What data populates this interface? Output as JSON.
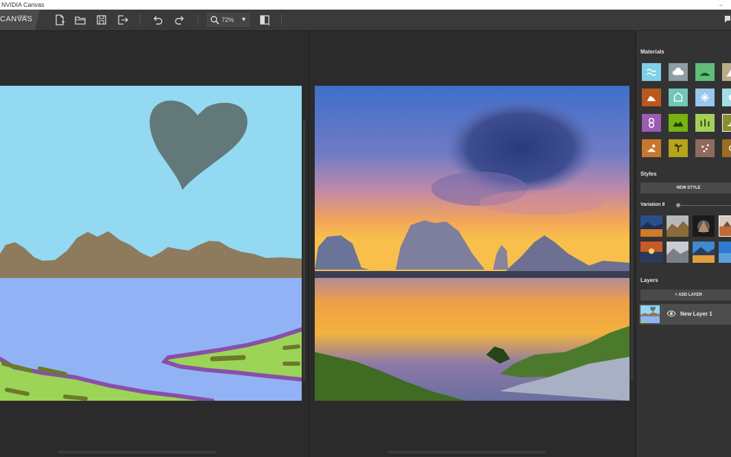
{
  "window": {
    "title": "NVIDIA Canvas"
  },
  "toolbar": {
    "brand": "CANVAS",
    "brand_badge": "BETA",
    "zoom_value": "72%",
    "buttons": [
      "new-file-icon",
      "open-folder-icon",
      "save-icon",
      "export-icon",
      "undo-icon",
      "redo-icon",
      "search-icon",
      "split-view-icon"
    ]
  },
  "sidebar": {
    "materials_title": "Materials",
    "materials": [
      {
        "name": "water",
        "color": "#7fd0e8",
        "icon": "water-icon"
      },
      {
        "name": "cloud",
        "color": "#8f9ea4",
        "icon": "cloud-icon"
      },
      {
        "name": "hill",
        "color": "#5fbf7a",
        "icon": "hill-icon"
      },
      {
        "name": "mountain",
        "color": "#b7ad8a",
        "icon": "mountain-icon"
      },
      {
        "name": "rock",
        "color": "#b9581c",
        "icon": "rock-icon"
      },
      {
        "name": "building",
        "color": "#72c6b8",
        "icon": "building-icon"
      },
      {
        "name": "snow",
        "color": "#98c7ef",
        "icon": "snowflake-icon"
      },
      {
        "name": "sky",
        "color": "#a3dde8",
        "icon": "sky-icon"
      },
      {
        "name": "flower",
        "color": "#9b5cb4",
        "icon": "flower-icon"
      },
      {
        "name": "grass",
        "color": "#76b212",
        "icon": "grass-icon"
      },
      {
        "name": "field",
        "color": "#a4d05a",
        "icon": "field-icon"
      },
      {
        "name": "plant",
        "color": "#8a8d2e",
        "icon": "plant-icon"
      },
      {
        "name": "dirt",
        "color": "#c8782e",
        "icon": "dirt-icon"
      },
      {
        "name": "palm",
        "color": "#b5a41c",
        "icon": "palm-icon"
      },
      {
        "name": "gravel",
        "color": "#8e6b5e",
        "icon": "gravel-icon"
      },
      {
        "name": "sand",
        "color": "#9b6c25",
        "icon": "sand-icon"
      }
    ],
    "styles_title": "Styles",
    "new_style_label": "NEW STYLE",
    "variation_label": "Variation 8",
    "layers_title": "Layers",
    "add_layer_label": "+ ADD LAYER",
    "layer_name": "New Layer 1"
  },
  "colors": {
    "background": "#2a2a2a",
    "sidebar": "#333333",
    "accent_selection": "#ffffff"
  }
}
